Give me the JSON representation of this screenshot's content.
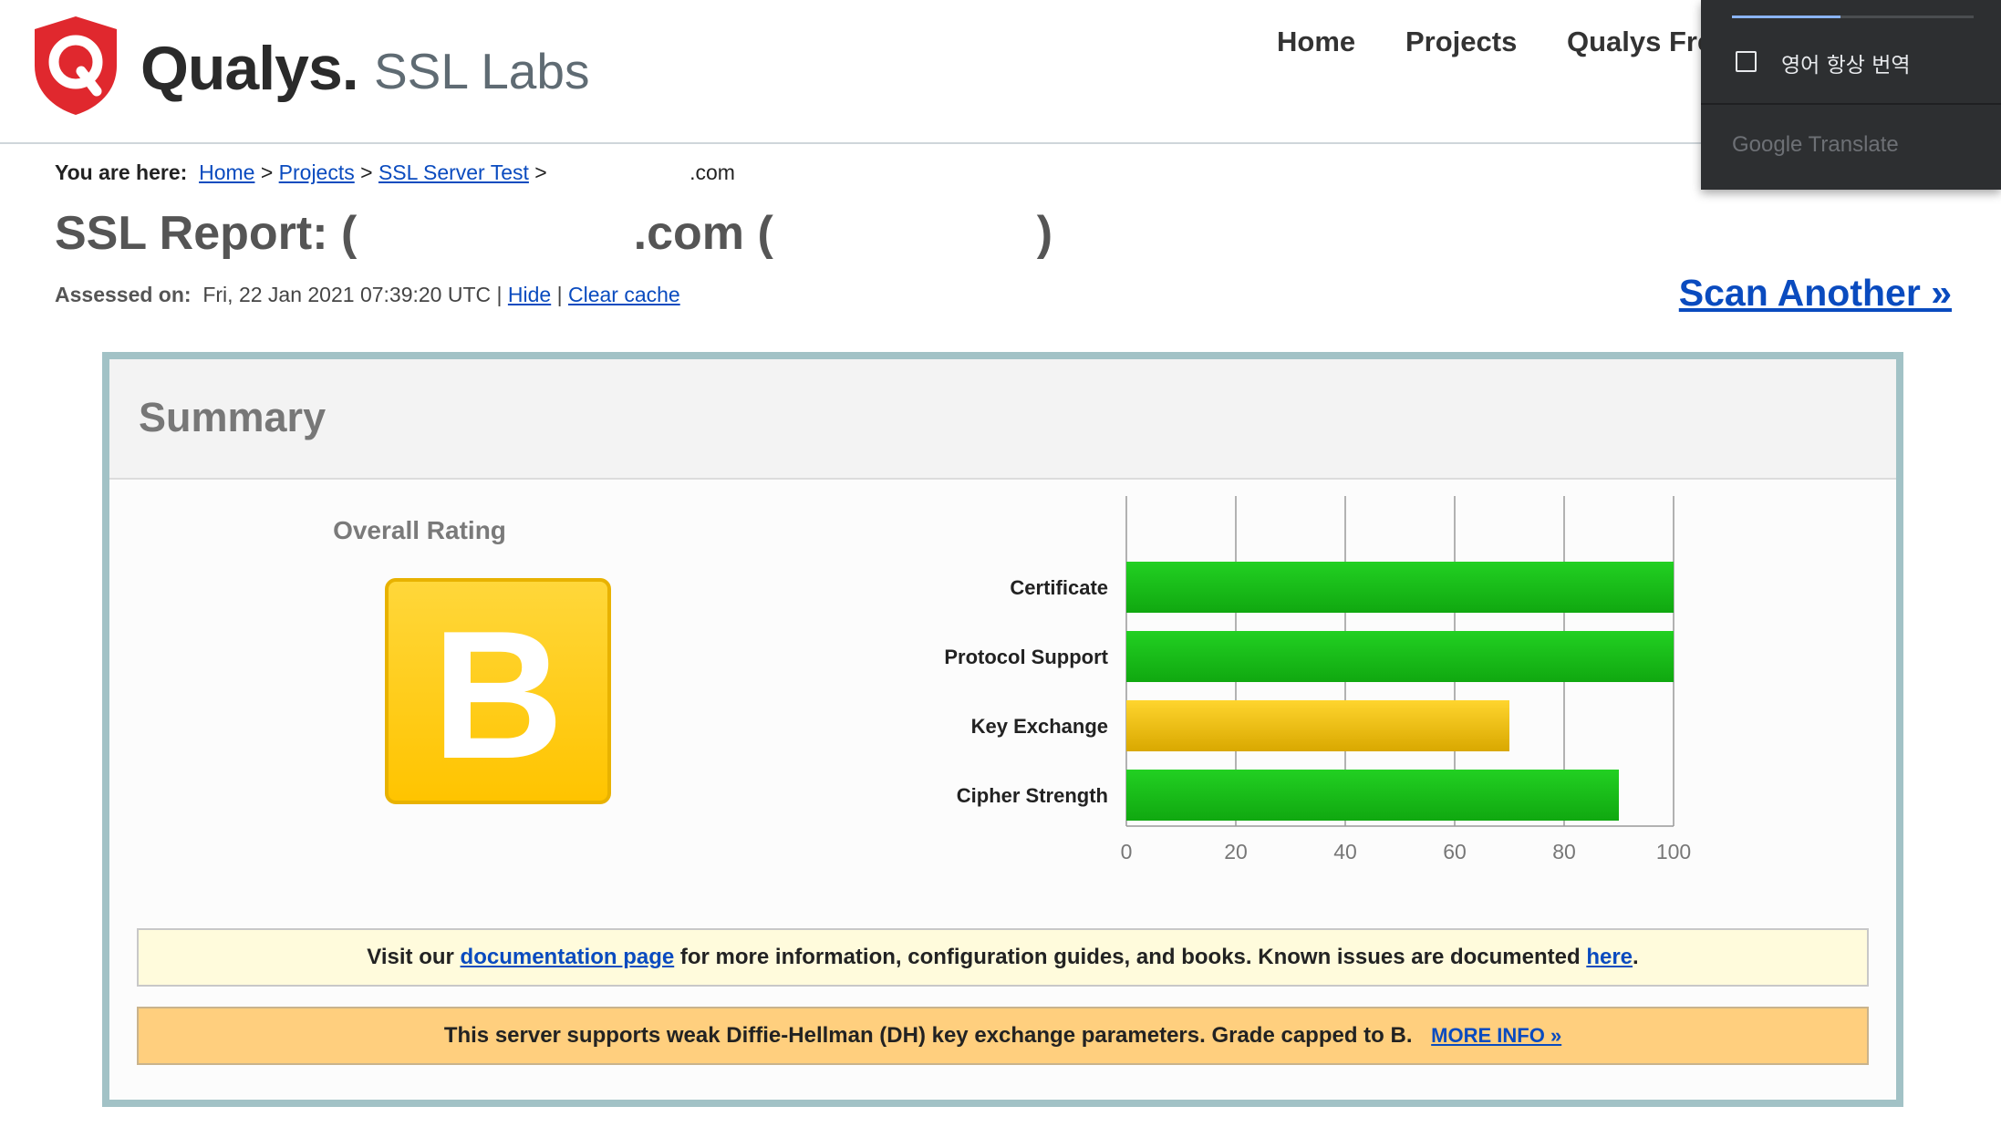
{
  "header": {
    "brand_name": "Qualys.",
    "brand_sub": "SSL Labs",
    "nav": [
      "Home",
      "Projects",
      "Qualys Fre"
    ]
  },
  "translate_popup": {
    "checkbox_label": "영어 항상 번역",
    "brand": "Google Translate"
  },
  "breadcrumb": {
    "label": "You are here:",
    "items": [
      "Home",
      "Projects",
      "SSL Server Test"
    ],
    "separator": ">",
    "current": ".com"
  },
  "report": {
    "title": "SSL Report: (                     .com (                    )",
    "assessed_label": "Assessed on:",
    "assessed_value": "Fri, 22 Jan 2021 07:39:20 UTC |",
    "hide_link": "Hide",
    "sep": "|",
    "clear_cache_link": "Clear cache",
    "scan_another": "Scan Another »"
  },
  "summary": {
    "title": "Summary",
    "overall_rating_label": "Overall Rating",
    "grade": "B"
  },
  "chart_data": {
    "type": "bar",
    "orientation": "horizontal",
    "categories": [
      "Certificate",
      "Protocol Support",
      "Key Exchange",
      "Cipher Strength"
    ],
    "values": [
      100,
      100,
      70,
      90
    ],
    "bar_colors": [
      "#18b818",
      "#18b818",
      "#e6b800",
      "#18b818"
    ],
    "xlim": [
      0,
      100
    ],
    "xticks": [
      0,
      20,
      40,
      60,
      80,
      100
    ],
    "grid": true
  },
  "notices": {
    "doc_prefix": "Visit our",
    "doc_link": "documentation page",
    "doc_middle": "for more information, configuration guides, and books. Known issues are documented",
    "doc_link2": "here",
    "doc_suffix": ".",
    "dh_text": "This server supports weak Diffie-Hellman (DH) key exchange parameters. Grade capped to B.",
    "dh_link": "MORE INFO »"
  },
  "colors": {
    "link": "#0a4bbf",
    "brand_red": "#e0282e",
    "grade_yellow": "#ffc400",
    "bar_green": "#18b818",
    "bar_yellow": "#e6b800"
  }
}
